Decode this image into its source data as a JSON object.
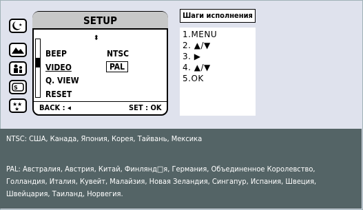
{
  "camera_screen": {
    "title": "SETUP",
    "up_down_indicator": "⬍",
    "menu": [
      {
        "label": "BEEP",
        "value": "NTSC"
      },
      {
        "label": "VIDEO",
        "value": "PAL"
      },
      {
        "label": "Q. VIEW",
        "value": ""
      },
      {
        "label": "RESET",
        "value": ""
      }
    ],
    "footer_left": "BACK : ◂",
    "footer_right": "SET : OK"
  },
  "mode_icons": [
    "night-mode-icon",
    "landscape-mode-icon",
    "portrait-mode-icon",
    "sport-mode-icon",
    "fireworks-mode-icon"
  ],
  "steps": {
    "title": "Шаги исполнения",
    "items": [
      "1.MENU",
      "2. ▲/▼",
      "3. ▶",
      "4. ▲/▼",
      "5.OK"
    ]
  },
  "notes": {
    "ntsc": "NTSC: США, Канада, Япония, Корея, Тайвань, Мексика",
    "pal": "PAL: Австралия, Австрия, Китай, Финлянд□я, Германия, Объединенное Королевство, Голландия, Италия, Кувейт, Малайзия, Новая Зеландия, Сингапур, Испания, Швеция, Швейцария, Таиланд, Норвегия."
  },
  "colors": {
    "panel_bg": "#dfe2ed",
    "notes_bg": "#546466",
    "title_bar": "#c7c8c8"
  }
}
